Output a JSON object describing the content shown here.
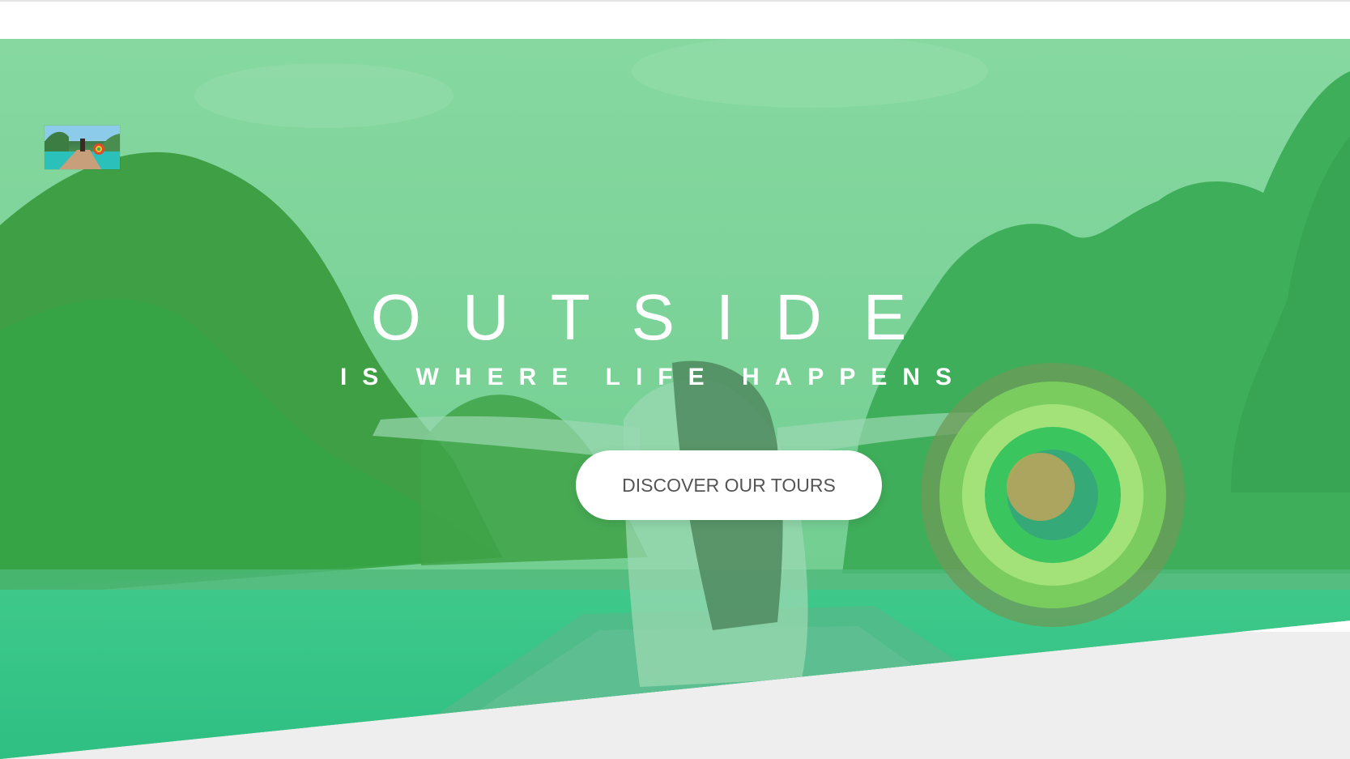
{
  "hero": {
    "headline": "OUTSIDE",
    "subheadline": "IS WHERE LIFE HAPPENS",
    "cta_label": "DISCOVER OUR TOURS"
  },
  "brand": {
    "logo_icon": "logo-photo-icon"
  },
  "colors": {
    "overlay_top": "#77cf8f",
    "overlay_bottom": "#3fc384",
    "button_bg": "#ffffff",
    "button_text": "#555555",
    "below_bg": "#eeeeee"
  }
}
